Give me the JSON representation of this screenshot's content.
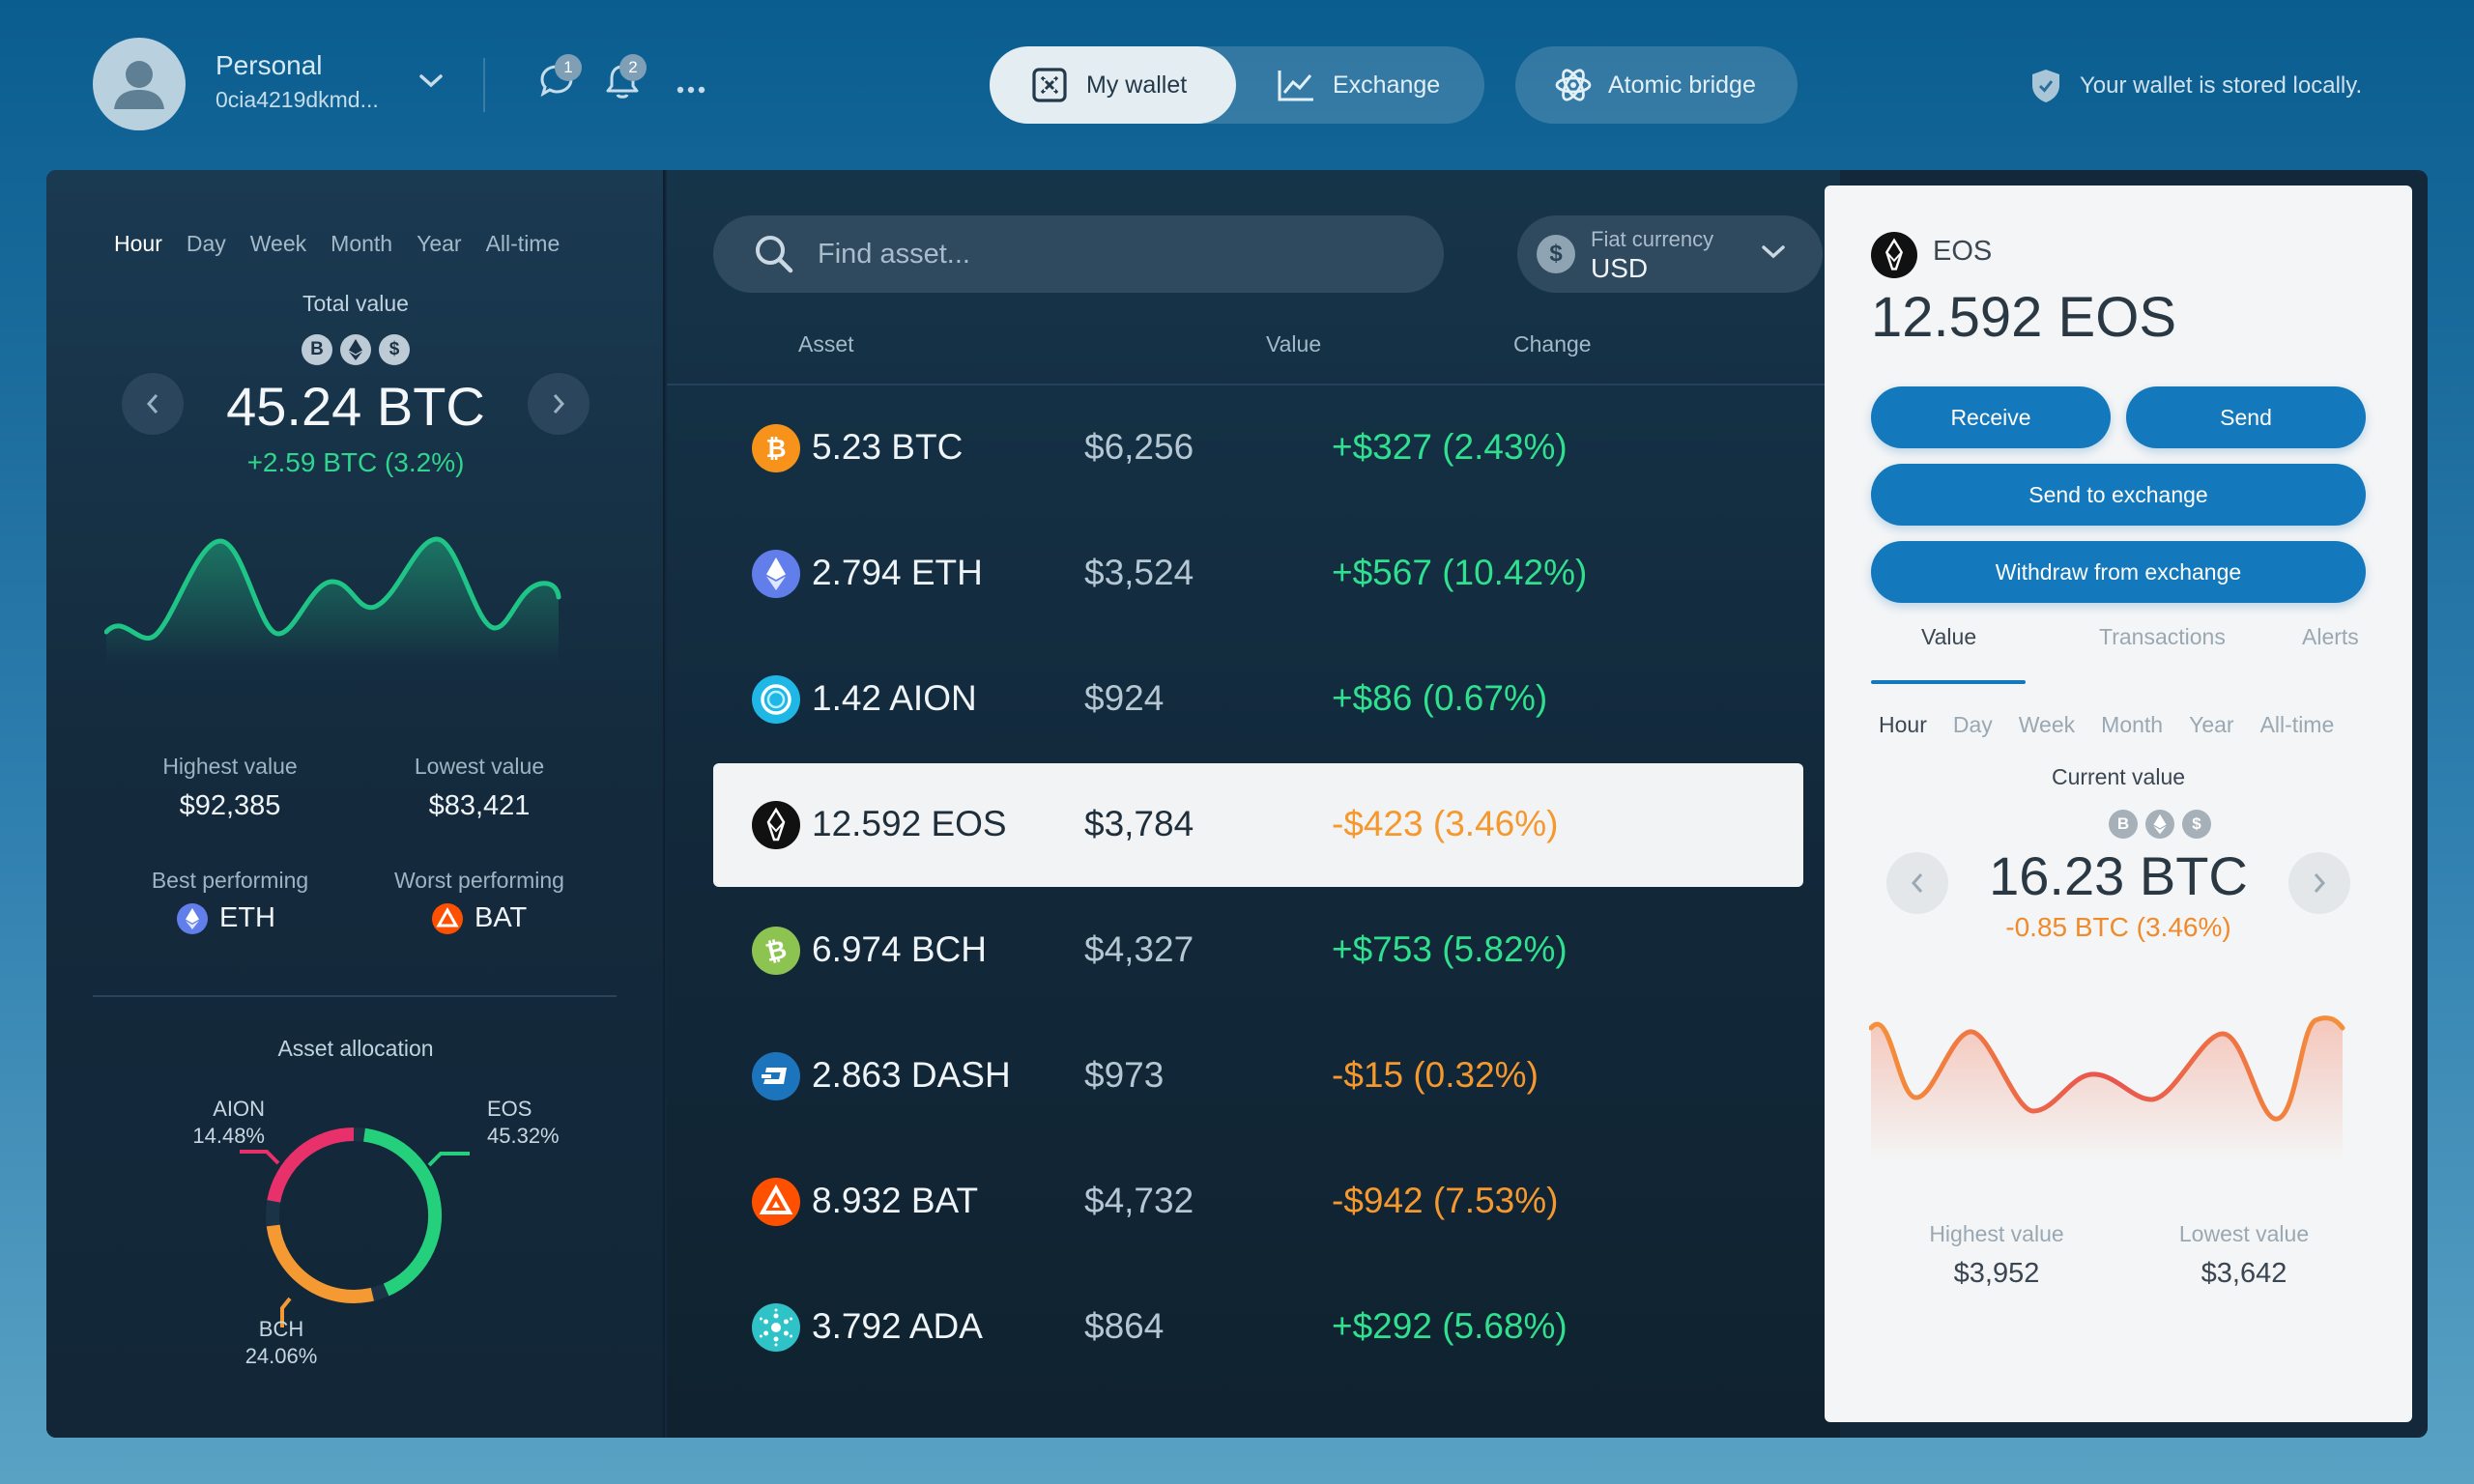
{
  "header": {
    "profile_name": "Personal",
    "profile_address": "0cia4219dkmd...",
    "messages_badge": "1",
    "notifications_badge": "2",
    "nav_wallet": "My wallet",
    "nav_exchange": "Exchange",
    "nav_atomic": "Atomic bridge",
    "local_note": "Your wallet is stored locally."
  },
  "summary": {
    "time_tabs": [
      "Hour",
      "Day",
      "Week",
      "Month",
      "Year",
      "All-time"
    ],
    "selected_time": "Hour",
    "total_label": "Total value",
    "total_value": "45.24 BTC",
    "total_change": "+2.59 BTC (3.2%)",
    "highest_label": "Highest value",
    "highest_value": "$92,385",
    "lowest_label": "Lowest value",
    "lowest_value": "$83,421",
    "best_label": "Best performing",
    "best_value": "ETH",
    "worst_label": "Worst performing",
    "worst_value": "BAT",
    "alloc_title": "Asset allocation",
    "alloc": {
      "aion_name": "AION",
      "aion_pct": "14.48%",
      "eos_name": "EOS",
      "eos_pct": "45.32%",
      "bch_name": "BCH",
      "bch_pct": "24.06%"
    }
  },
  "list": {
    "search_placeholder": "Find asset...",
    "fiat_label": "Fiat currency",
    "fiat_value": "USD",
    "col_asset": "Asset",
    "col_value": "Value",
    "col_change": "Change",
    "rows": [
      {
        "amount": "5.23 BTC",
        "value": "$6,256",
        "change": "+$327 (2.43%)"
      },
      {
        "amount": "2.794 ETH",
        "value": "$3,524",
        "change": "+$567 (10.42%)"
      },
      {
        "amount": "1.42 AION",
        "value": "$924",
        "change": "+$86 (0.67%)"
      },
      {
        "amount": "12.592 EOS",
        "value": "$3,784",
        "change": "-$423 (3.46%)"
      },
      {
        "amount": "6.974 BCH",
        "value": "$4,327",
        "change": "+$753 (5.82%)"
      },
      {
        "amount": "2.863 DASH",
        "value": "$973",
        "change": "-$15 (0.32%)"
      },
      {
        "amount": "8.932 BAT",
        "value": "$4,732",
        "change": "-$942 (7.53%)"
      },
      {
        "amount": "3.792 ADA",
        "value": "$864",
        "change": "+$292 (5.68%)"
      }
    ]
  },
  "detail": {
    "ticker": "EOS",
    "balance": "12.592 EOS",
    "receive": "Receive",
    "send": "Send",
    "send_exchange": "Send to exchange",
    "withdraw_exchange": "Withdraw from exchange",
    "tabs": [
      "Value",
      "Transactions",
      "Alerts"
    ],
    "time_tabs": [
      "Hour",
      "Day",
      "Week",
      "Month",
      "Year",
      "All-time"
    ],
    "current_label": "Current value",
    "current_value": "16.23 BTC",
    "current_change": "-0.85 BTC (3.46%)",
    "highest_label": "Highest value",
    "highest_value": "$3,952",
    "lowest_label": "Lowest value",
    "lowest_value": "$3,642"
  },
  "colors": {
    "positive": "#2fe08f",
    "negative": "#f5982e",
    "primary_button": "#1379bc"
  }
}
